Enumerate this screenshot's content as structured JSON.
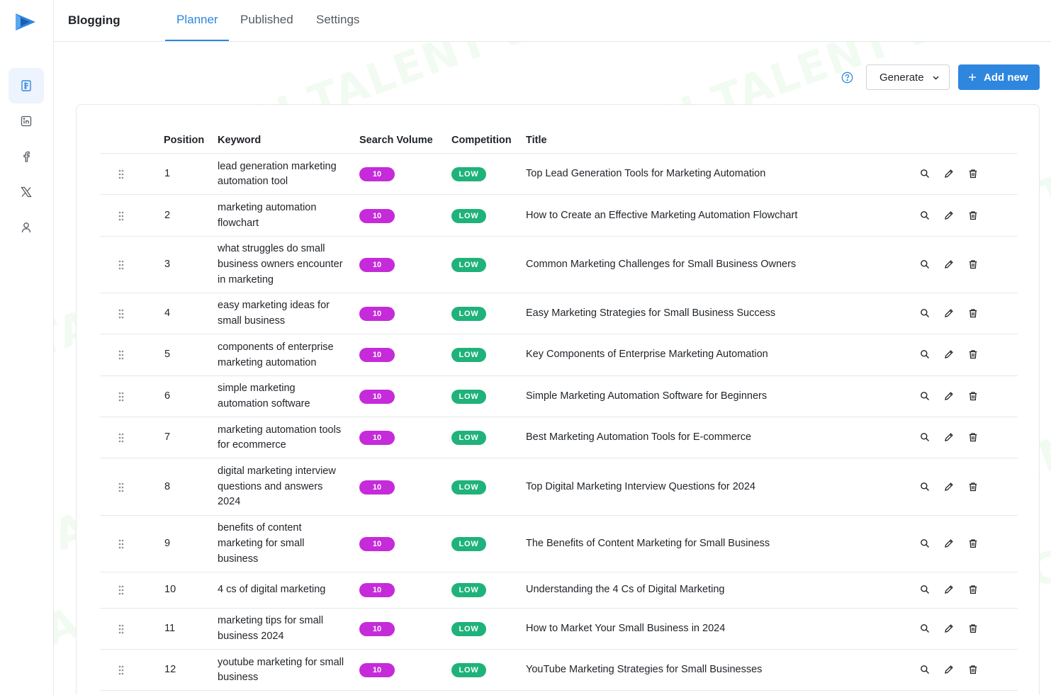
{
  "app": {
    "title": "Blogging",
    "tabs": [
      {
        "label": "Planner",
        "active": true
      },
      {
        "label": "Published",
        "active": false
      },
      {
        "label": "Settings",
        "active": false
      }
    ],
    "accent_color": "#2e86de"
  },
  "sidebar": {
    "items": [
      {
        "icon": "document-icon",
        "active": true
      },
      {
        "icon": "linkedin-icon",
        "active": false
      },
      {
        "icon": "facebook-icon",
        "active": false
      },
      {
        "icon": "x-twitter-icon",
        "active": false
      },
      {
        "icon": "user-icon",
        "active": false
      }
    ]
  },
  "toolbar": {
    "help_icon": "help-circle-icon",
    "generate_label": "Generate",
    "add_label": "Add new"
  },
  "watermark": {
    "text": "AI TALENT SPACE"
  },
  "table": {
    "headers": {
      "position": "Position",
      "keyword": "Keyword",
      "volume": "Search Volume",
      "competition": "Competition",
      "title": "Title"
    },
    "rows": [
      {
        "position": "1",
        "keyword_lines": [
          "lead generation marketing",
          "automation tool"
        ],
        "volume": "10",
        "competition": "LOW",
        "title": "Top Lead Generation Tools for Marketing Automation"
      },
      {
        "position": "2",
        "keyword_lines": [
          "marketing automation",
          "flowchart"
        ],
        "volume": "10",
        "competition": "LOW",
        "title": "How to Create an Effective Marketing Automation Flowchart"
      },
      {
        "position": "3",
        "keyword_lines": [
          "what struggles do small",
          "business owners encounter",
          "in marketing"
        ],
        "volume": "10",
        "competition": "LOW",
        "title": "Common Marketing Challenges for Small Business Owners"
      },
      {
        "position": "4",
        "keyword_lines": [
          "easy marketing ideas for",
          "small business"
        ],
        "volume": "10",
        "competition": "LOW",
        "title": "Easy Marketing Strategies for Small Business Success"
      },
      {
        "position": "5",
        "keyword_lines": [
          "components of enterprise",
          "marketing automation"
        ],
        "volume": "10",
        "competition": "LOW",
        "title": "Key Components of Enterprise Marketing Automation"
      },
      {
        "position": "6",
        "keyword_lines": [
          "simple marketing",
          "automation software"
        ],
        "volume": "10",
        "competition": "LOW",
        "title": "Simple Marketing Automation Software for Beginners"
      },
      {
        "position": "7",
        "keyword_lines": [
          "marketing automation tools",
          "for ecommerce"
        ],
        "volume": "10",
        "competition": "LOW",
        "title": "Best Marketing Automation Tools for E-commerce"
      },
      {
        "position": "8",
        "keyword_lines": [
          "digital marketing interview",
          "questions and answers",
          "2024"
        ],
        "volume": "10",
        "competition": "LOW",
        "title": "Top Digital Marketing Interview Questions for 2024"
      },
      {
        "position": "9",
        "keyword_lines": [
          "benefits of content",
          "marketing for small",
          "business"
        ],
        "volume": "10",
        "competition": "LOW",
        "title": "The Benefits of Content Marketing for Small Business"
      },
      {
        "position": "10",
        "keyword_lines": [
          "4 cs of digital marketing"
        ],
        "volume": "10",
        "competition": "LOW",
        "title": "Understanding the 4 Cs of Digital Marketing"
      },
      {
        "position": "11",
        "keyword_lines": [
          "marketing tips for small",
          "business 2024"
        ],
        "volume": "10",
        "competition": "LOW",
        "title": "How to Market Your Small Business in 2024"
      },
      {
        "position": "12",
        "keyword_lines": [
          "youtube marketing for small",
          "business"
        ],
        "volume": "10",
        "competition": "LOW",
        "title": "YouTube Marketing Strategies for Small Businesses"
      }
    ],
    "row_actions": [
      "search-icon",
      "edit-pencil-icon",
      "trash-icon"
    ],
    "volume_badge_color": "#c52bd9",
    "competition_badge_color": "#1fb27a"
  }
}
